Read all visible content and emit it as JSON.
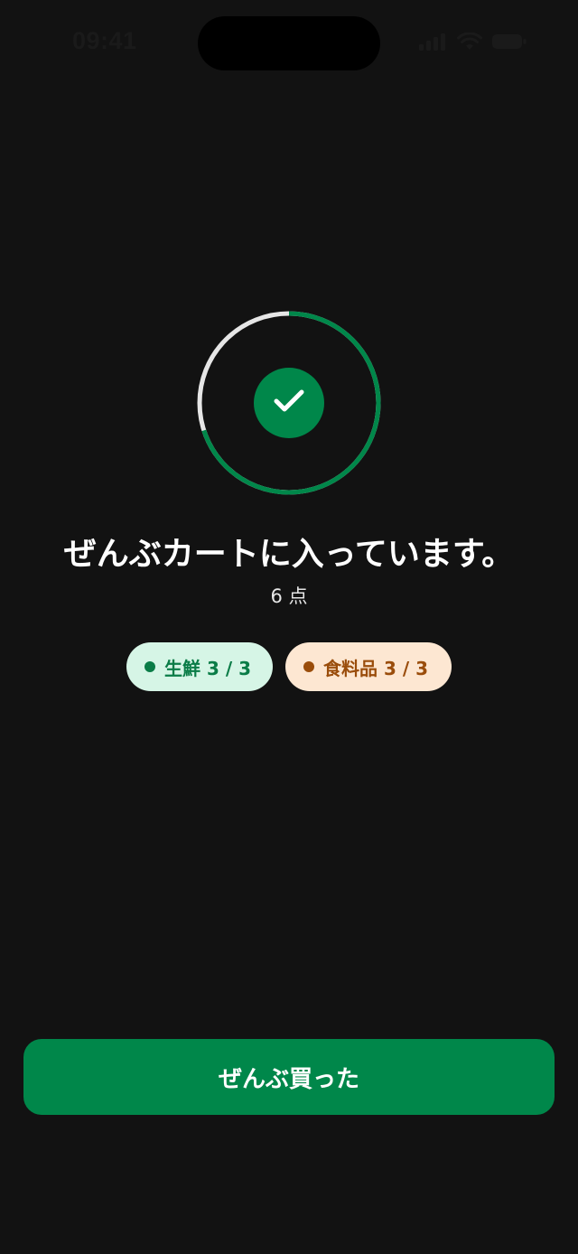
{
  "status_bar": {
    "time": "09:41",
    "icons": [
      "cellular-signal-icon",
      "wifi-icon",
      "battery-icon"
    ]
  },
  "progress": {
    "fraction_done": 0.7,
    "icon": "check-icon",
    "colors": {
      "ring_done": "#00874a",
      "ring_track": "#e6e6e6",
      "badge": "#00874a"
    }
  },
  "summary": {
    "headline": "ぜんぶカートに入っています。",
    "count": "6 点"
  },
  "chips": [
    {
      "label": "生鮮 3 / 3",
      "color": "#0a7c47",
      "background": "#d6f5e6"
    },
    {
      "label": "食料品 3 / 3",
      "color": "#9a4d0b",
      "background": "#fde7d2"
    }
  ],
  "actions": {
    "primary_label": "ぜんぶ買った",
    "primary_color": "#00874a"
  }
}
